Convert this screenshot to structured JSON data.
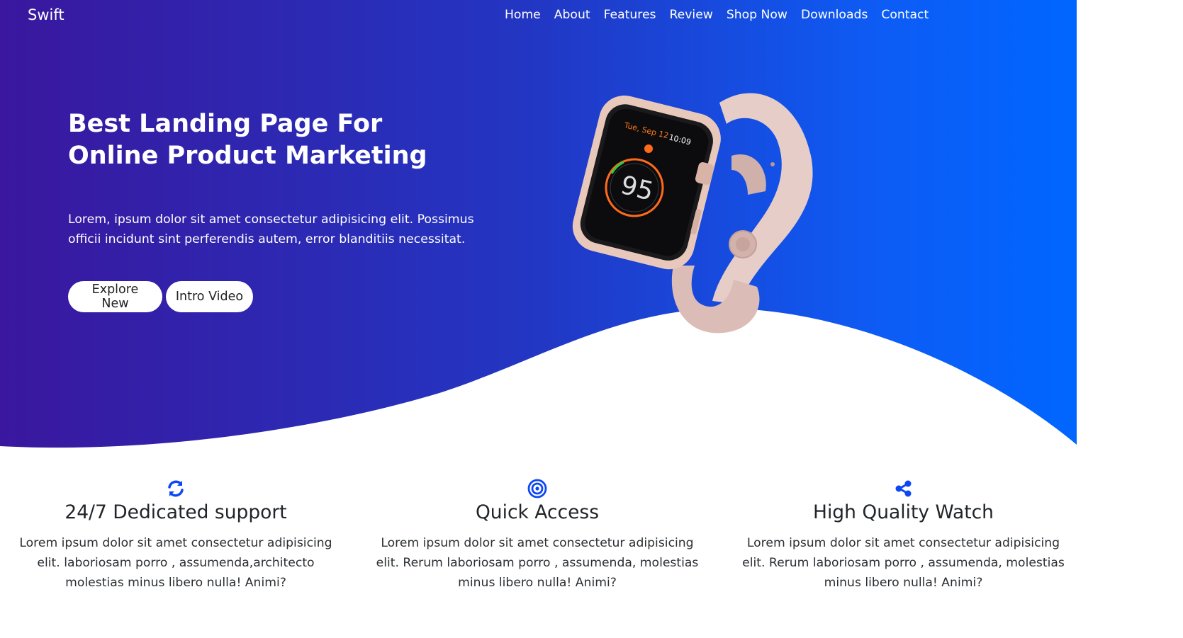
{
  "brand": "Swift",
  "nav": {
    "items": [
      "Home",
      "About",
      "Features",
      "Review",
      "Shop Now",
      "Downloads",
      "Contact"
    ]
  },
  "hero": {
    "title": "Best Landing Page For Online Product Marketing",
    "text": "Lorem, ipsum dolor sit amet consectetur adipisicing elit. Possimus officii incidunt sint perferendis autem, error blanditiis necessitat.",
    "buttons": {
      "explore": "Explore New",
      "video": "Intro Video"
    },
    "watch": {
      "date": "Tue, Sep 12",
      "time": "10:09",
      "value": "95"
    }
  },
  "features": [
    {
      "icon": "sync-icon",
      "title": "24/7 Dedicated support",
      "text": "Lorem ipsum dolor sit amet consectetur adipisicing elit. laboriosam porro , assumenda,architecto molestias minus libero nulla! Animi?"
    },
    {
      "icon": "bullseye-icon",
      "title": "Quick Access",
      "text": "Lorem ipsum dolor sit amet consectetur adipisicing elit. Rerum laboriosam porro , assumenda, molestias minus libero nulla! Animi?"
    },
    {
      "icon": "share-icon",
      "title": "High Quality Watch",
      "text": "Lorem ipsum dolor sit amet consectetur adipisicing elit. Rerum laboriosam porro , assumenda, molestias minus libero nulla! Animi?"
    }
  ],
  "colors": {
    "accent": "#0d47f5",
    "gradient_start": "#3a179e",
    "gradient_end": "#0066ff",
    "watch_band": "#e8cfcb"
  }
}
